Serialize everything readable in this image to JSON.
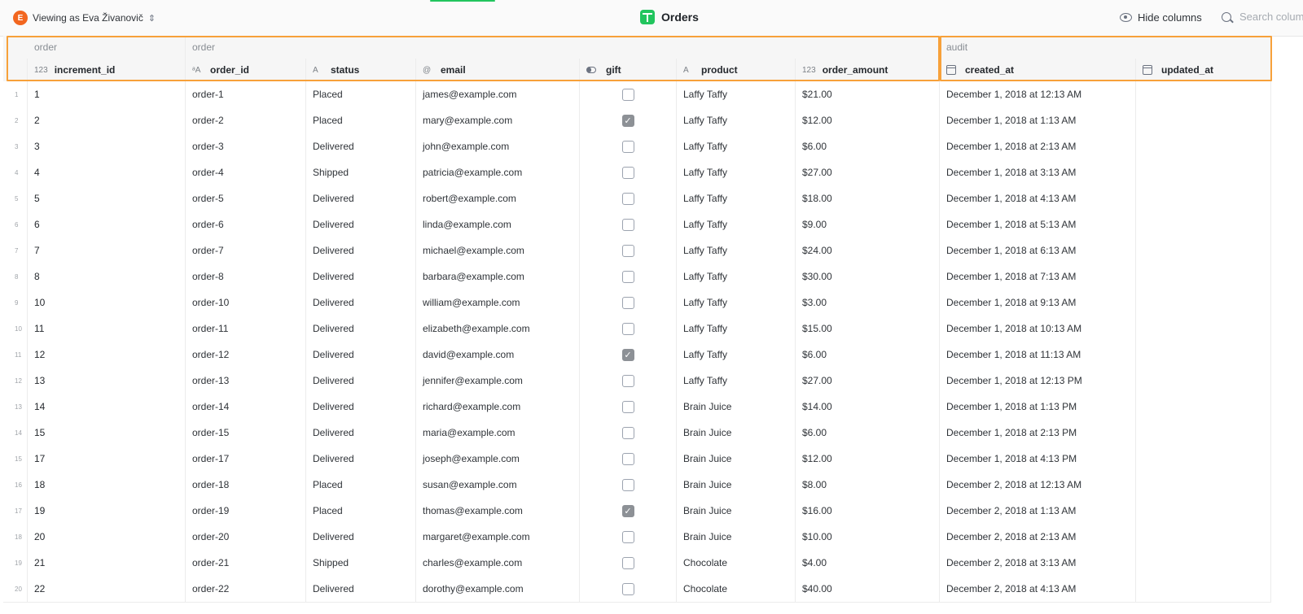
{
  "topbar": {
    "viewing_avatar_letter": "E",
    "viewing_label": "Viewing as Eva Živanovič",
    "title": "Orders",
    "hide_columns_label": "Hide columns",
    "search_placeholder": "Search columns"
  },
  "groups": [
    {
      "label": "order"
    },
    {
      "label": "order"
    },
    {
      "label": "audit"
    }
  ],
  "columns": [
    {
      "key": "increment_id",
      "label": "increment_id",
      "type_icon": "123"
    },
    {
      "key": "order_id",
      "label": "order_id",
      "type_icon": "ᵃA"
    },
    {
      "key": "status",
      "label": "status",
      "type_icon": "A"
    },
    {
      "key": "email",
      "label": "email",
      "type_icon": "@"
    },
    {
      "key": "gift",
      "label": "gift",
      "type_icon": "toggle"
    },
    {
      "key": "product",
      "label": "product",
      "type_icon": "A"
    },
    {
      "key": "order_amount",
      "label": "order_amount",
      "type_icon": "123"
    },
    {
      "key": "created_at",
      "label": "created_at",
      "type_icon": "calendar"
    },
    {
      "key": "updated_at",
      "label": "updated_at",
      "type_icon": "calendar"
    }
  ],
  "rows": [
    {
      "n": "1",
      "increment_id": "1",
      "order_id": "order-1",
      "status": "Placed",
      "email": "james@example.com",
      "gift": false,
      "product": "Laffy Taffy",
      "order_amount": "$21.00",
      "created_at": "December 1, 2018 at 12:13 AM",
      "updated_at": ""
    },
    {
      "n": "2",
      "increment_id": "2",
      "order_id": "order-2",
      "status": "Placed",
      "email": "mary@example.com",
      "gift": true,
      "product": "Laffy Taffy",
      "order_amount": "$12.00",
      "created_at": "December 1, 2018 at 1:13 AM",
      "updated_at": ""
    },
    {
      "n": "3",
      "increment_id": "3",
      "order_id": "order-3",
      "status": "Delivered",
      "email": "john@example.com",
      "gift": false,
      "product": "Laffy Taffy",
      "order_amount": "$6.00",
      "created_at": "December 1, 2018 at 2:13 AM",
      "updated_at": ""
    },
    {
      "n": "4",
      "increment_id": "4",
      "order_id": "order-4",
      "status": "Shipped",
      "email": "patricia@example.com",
      "gift": false,
      "product": "Laffy Taffy",
      "order_amount": "$27.00",
      "created_at": "December 1, 2018 at 3:13 AM",
      "updated_at": ""
    },
    {
      "n": "5",
      "increment_id": "5",
      "order_id": "order-5",
      "status": "Delivered",
      "email": "robert@example.com",
      "gift": false,
      "product": "Laffy Taffy",
      "order_amount": "$18.00",
      "created_at": "December 1, 2018 at 4:13 AM",
      "updated_at": ""
    },
    {
      "n": "6",
      "increment_id": "6",
      "order_id": "order-6",
      "status": "Delivered",
      "email": "linda@example.com",
      "gift": false,
      "product": "Laffy Taffy",
      "order_amount": "$9.00",
      "created_at": "December 1, 2018 at 5:13 AM",
      "updated_at": ""
    },
    {
      "n": "7",
      "increment_id": "7",
      "order_id": "order-7",
      "status": "Delivered",
      "email": "michael@example.com",
      "gift": false,
      "product": "Laffy Taffy",
      "order_amount": "$24.00",
      "created_at": "December 1, 2018 at 6:13 AM",
      "updated_at": ""
    },
    {
      "n": "8",
      "increment_id": "8",
      "order_id": "order-8",
      "status": "Delivered",
      "email": "barbara@example.com",
      "gift": false,
      "product": "Laffy Taffy",
      "order_amount": "$30.00",
      "created_at": "December 1, 2018 at 7:13 AM",
      "updated_at": ""
    },
    {
      "n": "9",
      "increment_id": "10",
      "order_id": "order-10",
      "status": "Delivered",
      "email": "william@example.com",
      "gift": false,
      "product": "Laffy Taffy",
      "order_amount": "$3.00",
      "created_at": "December 1, 2018 at 9:13 AM",
      "updated_at": ""
    },
    {
      "n": "10",
      "increment_id": "11",
      "order_id": "order-11",
      "status": "Delivered",
      "email": "elizabeth@example.com",
      "gift": false,
      "product": "Laffy Taffy",
      "order_amount": "$15.00",
      "created_at": "December 1, 2018 at 10:13 AM",
      "updated_at": ""
    },
    {
      "n": "11",
      "increment_id": "12",
      "order_id": "order-12",
      "status": "Delivered",
      "email": "david@example.com",
      "gift": true,
      "product": "Laffy Taffy",
      "order_amount": "$6.00",
      "created_at": "December 1, 2018 at 11:13 AM",
      "updated_at": ""
    },
    {
      "n": "12",
      "increment_id": "13",
      "order_id": "order-13",
      "status": "Delivered",
      "email": "jennifer@example.com",
      "gift": false,
      "product": "Laffy Taffy",
      "order_amount": "$27.00",
      "created_at": "December 1, 2018 at 12:13 PM",
      "updated_at": ""
    },
    {
      "n": "13",
      "increment_id": "14",
      "order_id": "order-14",
      "status": "Delivered",
      "email": "richard@example.com",
      "gift": false,
      "product": "Brain Juice",
      "order_amount": "$14.00",
      "created_at": "December 1, 2018 at 1:13 PM",
      "updated_at": ""
    },
    {
      "n": "14",
      "increment_id": "15",
      "order_id": "order-15",
      "status": "Delivered",
      "email": "maria@example.com",
      "gift": false,
      "product": "Brain Juice",
      "order_amount": "$6.00",
      "created_at": "December 1, 2018 at 2:13 PM",
      "updated_at": ""
    },
    {
      "n": "15",
      "increment_id": "17",
      "order_id": "order-17",
      "status": "Delivered",
      "email": "joseph@example.com",
      "gift": false,
      "product": "Brain Juice",
      "order_amount": "$12.00",
      "created_at": "December 1, 2018 at 4:13 PM",
      "updated_at": ""
    },
    {
      "n": "16",
      "increment_id": "18",
      "order_id": "order-18",
      "status": "Placed",
      "email": "susan@example.com",
      "gift": false,
      "product": "Brain Juice",
      "order_amount": "$8.00",
      "created_at": "December 2, 2018 at 12:13 AM",
      "updated_at": ""
    },
    {
      "n": "17",
      "increment_id": "19",
      "order_id": "order-19",
      "status": "Placed",
      "email": "thomas@example.com",
      "gift": true,
      "product": "Brain Juice",
      "order_amount": "$16.00",
      "created_at": "December 2, 2018 at 1:13 AM",
      "updated_at": ""
    },
    {
      "n": "18",
      "increment_id": "20",
      "order_id": "order-20",
      "status": "Delivered",
      "email": "margaret@example.com",
      "gift": false,
      "product": "Brain Juice",
      "order_amount": "$10.00",
      "created_at": "December 2, 2018 at 2:13 AM",
      "updated_at": ""
    },
    {
      "n": "19",
      "increment_id": "21",
      "order_id": "order-21",
      "status": "Shipped",
      "email": "charles@example.com",
      "gift": false,
      "product": "Chocolate",
      "order_amount": "$4.00",
      "created_at": "December 2, 2018 at 3:13 AM",
      "updated_at": ""
    },
    {
      "n": "20",
      "increment_id": "22",
      "order_id": "order-22",
      "status": "Delivered",
      "email": "dorothy@example.com",
      "gift": false,
      "product": "Chocolate",
      "order_amount": "$40.00",
      "created_at": "December 2, 2018 at 4:13 AM",
      "updated_at": ""
    }
  ],
  "colors": {
    "accent_orange": "#f7a13a",
    "avatar": "#f2661f",
    "brand_green": "#22c55e"
  }
}
